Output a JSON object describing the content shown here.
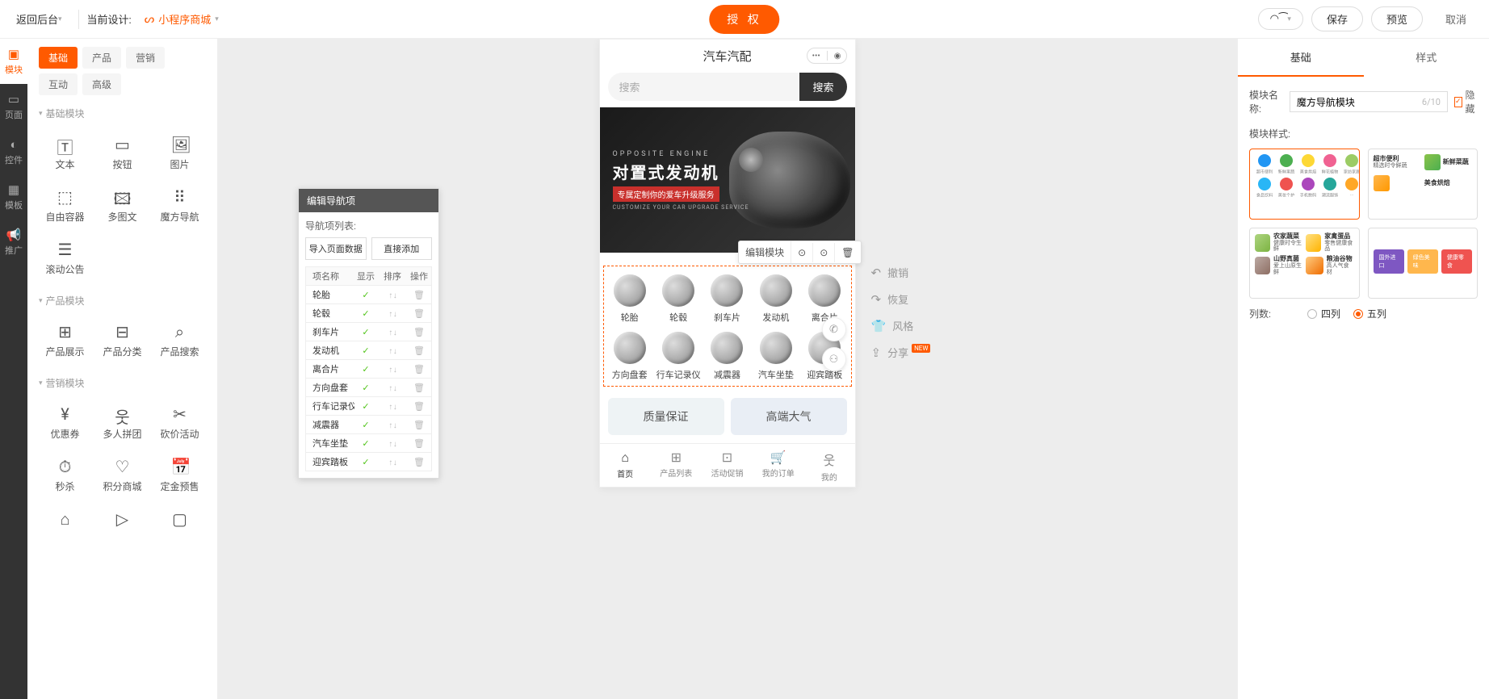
{
  "header": {
    "back": "返回后台",
    "current_design_label": "当前设计:",
    "design_name": "小程序商城",
    "auth": "授 权",
    "save": "保存",
    "preview": "预览",
    "cancel": "取消"
  },
  "rail": {
    "module": "模块",
    "page": "页面",
    "control": "控件",
    "template": "模板",
    "promo": "推广"
  },
  "module_tabs": [
    "基础",
    "产品",
    "营销",
    "互动",
    "高级"
  ],
  "module_groups": {
    "basic_title": "基础模块",
    "product_title": "产品模块",
    "market_title": "营销模块"
  },
  "modules": {
    "text": "文本",
    "button": "按钮",
    "image": "图片",
    "free_container": "自由容器",
    "multi_img": "多图文",
    "magic_nav": "魔方导航",
    "scroll_notice": "滚动公告",
    "product_show": "产品展示",
    "product_cat": "产品分类",
    "product_search": "产品搜索",
    "coupon": "优惠券",
    "group_buy": "多人拼团",
    "bargain": "砍价活动",
    "seckill": "秒杀",
    "points_mall": "积分商城",
    "deposit": "定金预售"
  },
  "edit_popup": {
    "title": "编辑导航项",
    "list_label": "导航项列表:",
    "import_btn": "导入页面数据",
    "add_btn": "直接添加",
    "cols": {
      "name": "项名称",
      "show": "显示",
      "sort": "排序",
      "op": "操作"
    },
    "rows": [
      "轮胎",
      "轮毂",
      "刹车片",
      "发动机",
      "离合片",
      "方向盘套",
      "行车记录仪",
      "减震器",
      "汽车坐垫",
      "迎宾踏板"
    ]
  },
  "phone": {
    "title": "汽车汽配",
    "search_placeholder": "搜索",
    "search_btn": "搜索",
    "banner": {
      "eng": "OPPOSITE ENGINE",
      "cn": "对置式发动机",
      "sub": "专属定制你的爱车升级服务",
      "eng2": "CUSTOMIZE YOUR CAR UPGRADE SERVICE"
    },
    "edit_module": "编辑模块",
    "nav": [
      "轮胎",
      "轮毂",
      "刹车片",
      "发动机",
      "离合片",
      "方向盘套",
      "行车记录仪",
      "减震器",
      "汽车坐垫",
      "迎宾踏板"
    ],
    "card1": "质量保证",
    "card2": "高端大气",
    "tabbar": [
      "首页",
      "产品列表",
      "活动促销",
      "我的订单",
      "我的"
    ]
  },
  "float_tools": {
    "undo": "撤销",
    "redo": "恢复",
    "style": "风格",
    "share": "分享",
    "new": "NEW"
  },
  "prop": {
    "tabs": {
      "basic": "基础",
      "style": "样式"
    },
    "name_label": "模块名称:",
    "name_value": "魔方导航模块",
    "name_count": "6/10",
    "hide_label": "隐藏",
    "style_label": "模块样式:",
    "style1": {
      "labels": [
        "超市便利",
        "新鲜果蔬",
        "美食烘焙",
        "鲜花植物",
        "家纺家居",
        "食品饮料",
        "美妆个护",
        "手机数码",
        "潮流服饰",
        "..."
      ]
    },
    "style2": {
      "a": {
        "t": "超市便利",
        "s": "精选时令鲜蔬"
      },
      "b": {
        "t": "新鲜菜蔬",
        "s": "..."
      },
      "c": {
        "t": "美食烘焙",
        "s": "..."
      }
    },
    "style3": {
      "a": {
        "t": "农家蔬菜",
        "s": "健康时令生鲜"
      },
      "b": {
        "t": "家禽蛋品",
        "s": "零售健康食品"
      },
      "c": {
        "t": "山野真菌",
        "s": "爱上山原生鲜"
      },
      "d": {
        "t": "粮油谷物",
        "s": "高人气食材"
      }
    },
    "style4": {
      "p1": "国外进口",
      "p2": "绿色美味",
      "p3": "健康零食"
    },
    "cols_label": "列数:",
    "cols4": "四列",
    "cols5": "五列"
  }
}
